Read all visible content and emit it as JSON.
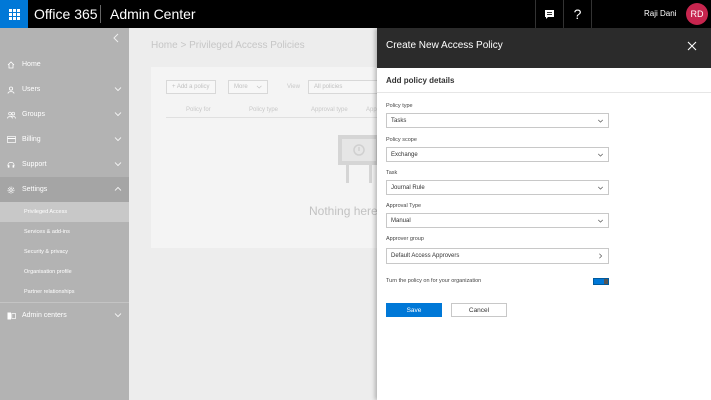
{
  "header": {
    "brand": "Office 365",
    "app_title": "Admin Center",
    "user_name": "Raji Dani",
    "avatar_initials": "RD",
    "accent_color": "#0078d7"
  },
  "sidebar": {
    "items": [
      {
        "label": "Home",
        "icon": "home-icon"
      },
      {
        "label": "Users",
        "icon": "user-icon"
      },
      {
        "label": "Groups",
        "icon": "group-icon"
      },
      {
        "label": "Billing",
        "icon": "billing-icon"
      },
      {
        "label": "Support",
        "icon": "headset-icon"
      },
      {
        "label": "Settings",
        "icon": "gear-icon"
      }
    ],
    "settings_sub": [
      {
        "label": "Privileged Access",
        "active": true
      },
      {
        "label": "Services & add-ins"
      },
      {
        "label": "Security & privacy"
      },
      {
        "label": "Organisation profile"
      },
      {
        "label": "Partner relationships"
      }
    ],
    "admin_centers": "Admin centers"
  },
  "main": {
    "breadcrumb": "Home > Privileged Access Policies",
    "add_policy": "+ Add a policy",
    "more": "More",
    "view_label": "View",
    "view_value": "All policies",
    "columns": [
      "Policy for",
      "Policy type",
      "Approval type",
      "App"
    ],
    "empty_text": "Nothing here"
  },
  "panel": {
    "title": "Create New Access Policy",
    "section_title": "Add policy details",
    "fields": [
      {
        "label": "Policy type",
        "value": "Tasks"
      },
      {
        "label": "Policy scope",
        "value": "Exchange"
      },
      {
        "label": "Task",
        "value": "Journal Rule"
      },
      {
        "label": "Approval Type",
        "value": "Manual"
      },
      {
        "label": "Approver group",
        "value": "Default Access Approvers"
      }
    ],
    "toggle_label": "Turn the policy on for your organization",
    "save": "Save",
    "cancel": "Cancel"
  }
}
